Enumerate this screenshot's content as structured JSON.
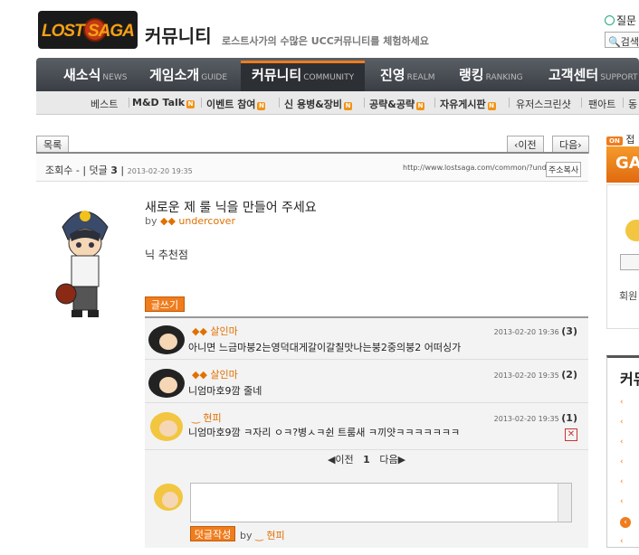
{
  "header": {
    "logo_text": "LOST SAGA",
    "section_title": "커뮤니티",
    "section_sub": "로스트사가의 수많은 UCC커뮤니티를 체험하세요",
    "question_link": "질문",
    "search_label": "검색"
  },
  "nav": [
    {
      "label": "새소식",
      "en": "NEWS"
    },
    {
      "label": "게임소개",
      "en": "GUIDE"
    },
    {
      "label": "커뮤니티",
      "en": "COMMUNITY"
    },
    {
      "label": "진영",
      "en": "REALM"
    },
    {
      "label": "랭킹",
      "en": "RANKING"
    },
    {
      "label": "고객센터",
      "en": "SUPPORT"
    }
  ],
  "subnav": [
    "베스트",
    "M&D Talk",
    "이벤트 참여",
    "신 용병&장비",
    "공략&공략",
    "자유게시판",
    "유저스크린샷",
    "팬아트",
    "동"
  ],
  "toolbar": {
    "list_label": "목록",
    "prev_label": "이전",
    "next_label": "다음"
  },
  "info": {
    "views": "조회수 -",
    "comments_label": "덧글",
    "comments_count": "3",
    "date": "2013-02-20 19:35",
    "url": "http://www.lostsaga.com/common/?undercover",
    "copy_label": "주소복사"
  },
  "post": {
    "title": "새로운 제 룰 닉을  만들어 주세요",
    "by": "by",
    "author": "undercover",
    "body": "닉 추천점"
  },
  "write_label": "글쓰기",
  "comments": [
    {
      "name": "살인마",
      "date": "2013-02-20 19:36",
      "num": "(3)",
      "text": "아니면 느금마붕2는영덕대게갈이갈칠맛나는붕2중의붕2 어떠싱가"
    },
    {
      "name": "살인마",
      "date": "2013-02-20 19:35",
      "num": "(2)",
      "text": "니엄마호9깜 줄네"
    },
    {
      "name": "현피",
      "date": "2013-02-20 19:35",
      "num": "(1)",
      "text": "니엄마호9깜 ㅋ자리 ㅇㅋ?병ㅅㅋ쉰 트룸새 ㅋ끼얏ㅋㅋㅋㅋㅋㅋㅋ"
    }
  ],
  "pager": {
    "prev": "◀이전",
    "page": "1",
    "next": "다음▶"
  },
  "reply": {
    "submit_label": "덧글작성",
    "by": "by",
    "user": "현피"
  },
  "sidebar": {
    "on_badge": "ON",
    "on_text": "접",
    "banner_text": "GA",
    "member_text": "회원",
    "community_title": "커뮤"
  },
  "colors": {
    "accent": "#f07c1c",
    "nav_bg": "#4a4e55"
  }
}
